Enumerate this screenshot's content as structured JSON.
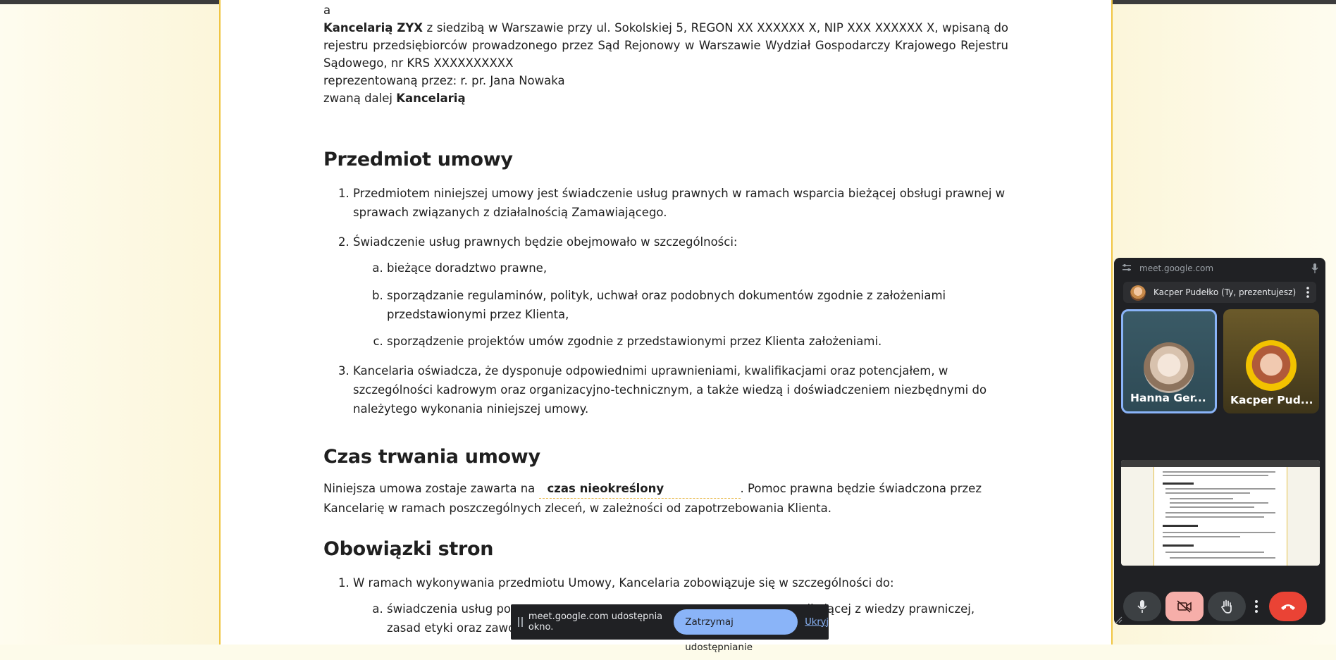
{
  "document": {
    "intro": {
      "and_word": "a",
      "firm_name": "Kancelarią ZYX",
      "firm_details": " z siedzibą w Warszawie przy ul. Sokolskiej 5, REGON XX XXXXXX X, NIP XXX XXXXXX X, wpisaną do rejestru przedsiębiorców prowadzonego przez Sąd Rejonowy w Warszawie Wydział Gospodarczy Krajowego Rejestru Sądowego, nr KRS XXXXXXXXXX",
      "represented_by": "reprezentowaną przez: r. pr. Jana Nowaka",
      "called_prefix": "zwaną dalej ",
      "called_name": "Kancelarią"
    },
    "section1": {
      "title": "Przedmiot umowy",
      "item1": "Przedmiotem niniejszej umowy jest świadczenie usług prawnych w ramach wsparcia bieżącej obsługi prawnej w sprawach związanych z działalnością Zamawiającego.",
      "item2": "Świadczenie usług prawnych będzie obejmowało w szczególności:",
      "item2_sub": [
        "bieżące doradztwo prawne,",
        "sporządzanie regulaminów, polityk, uchwał oraz podobnych dokumentów zgodnie z założeniami przedstawionymi przez Klienta,",
        "sporządzenie projektów umów zgodnie z przedstawionymi przez Klienta założeniami."
      ],
      "item3": "Kancelaria oświadcza, że dysponuje odpowiednimi uprawnieniami, kwalifikacjami oraz potencjałem, w szczególności kadrowym oraz organizacyjno-technicznym, a także wiedzą i doświadczeniem niezbędnymi do należytego wykonania niniejszej umowy."
    },
    "section2": {
      "title": "Czas trwania umowy",
      "text_before": "Niniejsza umowa zostaje zawarta na",
      "fill_value": "czas nieokreślony",
      "text_after": ". Pomoc prawna będzie świadczona przez Kancelarię w ramach poszczególnych zleceń, w zależności od zapotrzebowania Klienta."
    },
    "section3": {
      "title": "Obowiązki stron",
      "item1": "W ramach wykonywania przedmiotu Umowy, Kancelaria zobowiązuje się w szczególności do:",
      "sub_a_start": "świadczenia usług po",
      "sub_a_end": "nikającej z wiedzy prawniczej,",
      "sub_a_line2": "zasad etyki oraz zawodowego charakteru prowadzonej działalności."
    }
  },
  "share_banner": {
    "message": "meet.google.com udostępnia okno.",
    "stop_label": "Zatrzymaj udostępnianie",
    "hide_label": "Ukryj"
  },
  "meet_pip": {
    "url": "meet.google.com",
    "presenter": "Kacper Pudełko (Ty, prezentujesz)",
    "participants": [
      {
        "name": "Hanna Ger..."
      },
      {
        "name": "Kacper Pud..."
      }
    ],
    "colors": {
      "end_call": "#ea4335",
      "camera_off": "#f6aea9",
      "active_speaker": "#8ab4f8"
    }
  }
}
